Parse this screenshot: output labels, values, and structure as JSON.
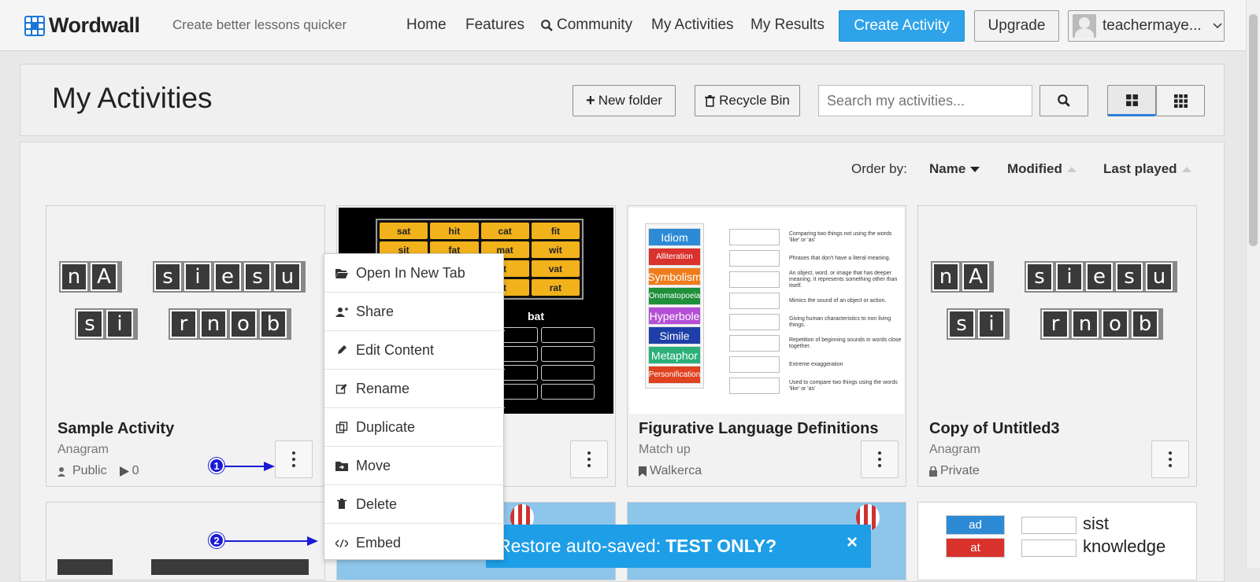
{
  "topbar": {
    "logo": "Wordwall",
    "tagline": "Create better lessons quicker",
    "nav": [
      "Home",
      "Features",
      "Community",
      "My Activities",
      "My Results"
    ],
    "create_label": "Create Activity",
    "upgrade_label": "Upgrade",
    "username": "teachermaye..."
  },
  "header": {
    "title": "My Activities",
    "new_folder": "New folder",
    "recycle_bin": "Recycle Bin",
    "search_placeholder": "Search my activities..."
  },
  "order": {
    "label": "Order by:",
    "name": "Name",
    "modified": "Modified",
    "last_played": "Last played"
  },
  "cards": [
    {
      "title": "Sample Activity",
      "type": "Anagram",
      "visibility": "Public",
      "plays": "0",
      "tiles_row1": [
        [
          "n",
          "A"
        ],
        [
          "s",
          "i",
          "e",
          "s",
          "u"
        ]
      ],
      "tiles_row2": [
        [
          "s",
          "i"
        ],
        [
          "r",
          "n",
          "o",
          "b"
        ]
      ]
    },
    {
      "title": "",
      "type": "",
      "grid": [
        "sat",
        "hit",
        "cat",
        "fit",
        "sit",
        "fat",
        "mat",
        "wit",
        "",
        "",
        "t",
        "vat",
        "",
        "",
        "t",
        "rat"
      ],
      "label": "bat"
    },
    {
      "title": "Figurative Language Definitions",
      "type": "Match up",
      "author": "Walkerca",
      "terms": [
        {
          "t": "Idiom",
          "c": "#2d8bd6",
          "d": "Comparing two things not using the words 'like' or 'as'"
        },
        {
          "t": "Alliteration",
          "c": "#d9312b",
          "d": "Phrases that don't have a literal meaning."
        },
        {
          "t": "Symbolism",
          "c": "#ef7d1d",
          "d": "An object, word, or image that has deeper meaning. It represents something other than itself."
        },
        {
          "t": "Onomatopoeia",
          "c": "#1f8f3a",
          "d": "Mimics the sound of an object or action."
        },
        {
          "t": "Hyperbole",
          "c": "#b44fd6",
          "d": "Giving human characteristics to non living things."
        },
        {
          "t": "Simile",
          "c": "#1e3fa8",
          "d": "Repetition of beginning sounds in words close together."
        },
        {
          "t": "Metaphor",
          "c": "#2bb07a",
          "d": "Extreme exaggeration"
        },
        {
          "t": "Personification",
          "c": "#e0411e",
          "d": "Used to compare two things using the words 'like' or 'as'"
        }
      ]
    },
    {
      "title": "Copy of Untitled3",
      "type": "Anagram",
      "visibility": "Private",
      "tiles_row1": [
        [
          "n",
          "A"
        ],
        [
          "s",
          "i",
          "e",
          "s",
          "u"
        ]
      ],
      "tiles_row2": [
        [
          "s",
          "i"
        ],
        [
          "r",
          "n",
          "o",
          "b"
        ]
      ]
    }
  ],
  "row2_card4": {
    "terms": [
      {
        "t": "ad",
        "c": "#2d8bd6",
        "w": "sist"
      },
      {
        "t": "at",
        "c": "#d9312b",
        "w": "knowledge"
      }
    ]
  },
  "menu": [
    "Open In New Tab",
    "Share",
    "Edit Content",
    "Rename",
    "Duplicate",
    "Move",
    "Delete",
    "Embed"
  ],
  "banner": {
    "text": "Restore auto-saved:",
    "bold": "TEST ONLY?",
    "close": "×"
  },
  "callouts": [
    "1",
    "2"
  ],
  "icons": {
    "community": "search-icon",
    "user_menu": "chevron-down-icon"
  },
  "colors": {
    "accent": "#2ea3ea",
    "banner": "#1e9ee6",
    "callout": "#1a1ad6"
  }
}
